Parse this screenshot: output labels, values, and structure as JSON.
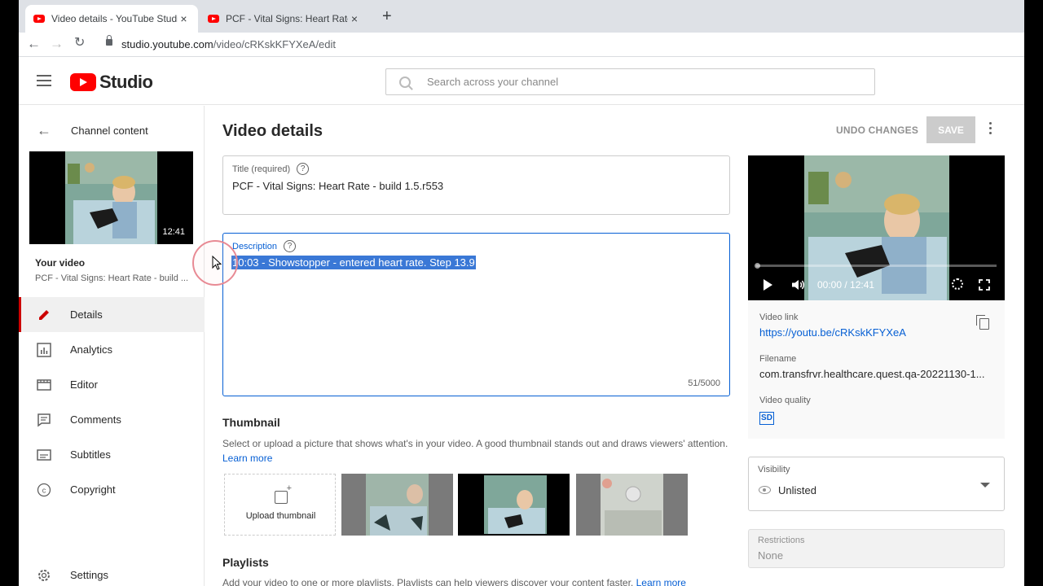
{
  "browser": {
    "tabs": [
      {
        "title": "Video details - YouTube Studio",
        "close": "×"
      },
      {
        "title": "PCF - Vital Signs: Heart Rate - bu",
        "close": "×"
      }
    ],
    "new_tab": "+",
    "back": "←",
    "forward": "→",
    "url_host": "studio.youtube.com",
    "url_path": "/video/cRKskKFYXeA/edit"
  },
  "header": {
    "logo_text": "Studio",
    "search_placeholder": "Search across your channel"
  },
  "sidebar": {
    "back_label": "Channel content",
    "thumb_duration": "12:41",
    "your_video_label": "Your video",
    "video_title": "PCF - Vital Signs: Heart Rate - build ...",
    "items": [
      {
        "label": "Details",
        "icon": "pencil-icon",
        "active": true
      },
      {
        "label": "Analytics",
        "icon": "analytics-icon"
      },
      {
        "label": "Editor",
        "icon": "editor-icon"
      },
      {
        "label": "Comments",
        "icon": "comments-icon"
      },
      {
        "label": "Subtitles",
        "icon": "subtitles-icon"
      },
      {
        "label": "Copyright",
        "icon": "copyright-icon"
      },
      {
        "label": "Settings",
        "icon": "gear-icon"
      }
    ]
  },
  "main": {
    "page_title": "Video details",
    "undo_label": "UNDO CHANGES",
    "save_label": "SAVE",
    "title_field": {
      "label": "Title (required)",
      "help": "?",
      "value": "PCF - Vital Signs: Heart Rate - build 1.5.r553"
    },
    "description_field": {
      "label": "Description",
      "help": "?",
      "value": "10:03 - Showstopper - entered heart rate. Step 13.9",
      "count": "51/5000"
    },
    "thumbnail": {
      "heading": "Thumbnail",
      "description": "Select or upload a picture that shows what's in your video. A good thumbnail stands out and draws viewers' attention.",
      "learn_more": "Learn more",
      "upload_label": "Upload thumbnail",
      "selected_index": 1
    },
    "playlists": {
      "heading": "Playlists",
      "description": "Add your video to one or more playlists. Playlists can help viewers discover your content faster.",
      "learn_more": "Learn more"
    }
  },
  "right_panel": {
    "player": {
      "time": "00:00 / 12:41",
      "progress": 0
    },
    "video_link_label": "Video link",
    "video_link": "https://youtu.be/cRKskKFYXeA",
    "filename_label": "Filename",
    "filename": "com.transfrvr.healthcare.quest.qa-20221130-1...",
    "quality_label": "Video quality",
    "quality_badge": "SD",
    "visibility_label": "Visibility",
    "visibility_value": "Unlisted",
    "restrictions_label": "Restrictions",
    "restrictions_value": "None"
  },
  "colors": {
    "accent": "#065fd4",
    "brand": "#ff0000",
    "active_nav": "#cc0000"
  }
}
